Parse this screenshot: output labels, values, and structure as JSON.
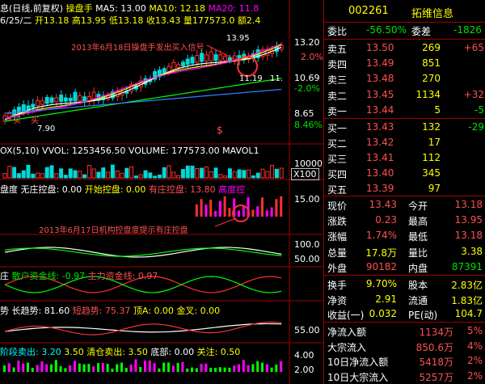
{
  "colors": {
    "up": "#ff3030",
    "down": "#00d8d8",
    "ma5": "#ffffff",
    "ma10": "#ffff00",
    "ma20": "#ff00ff",
    "ma60": "#00ff00",
    "ma120": "#3080ff",
    "grid": "#a00000",
    "accent": "#ff3030"
  },
  "kline": {
    "header_prefix": "息(日线,前复权)",
    "indicator_name": "操盘手",
    "ma5": "MA5: 13.00",
    "ma10": "MA10: 12.18",
    "ma20": "MA20: 11.8",
    "date": "6/25/二",
    "open": "开13.18",
    "high": "高13.95",
    "low": "低13.18",
    "close": "收13.43",
    "vol": "量177573.0",
    "amount": "额2.4",
    "annotation": "2013年6月18日操盘手发出买入信号",
    "price_high": "13.95",
    "price_mid": "11.19",
    "price_mid2": "11.",
    "price_low": "7.90",
    "buy_marks": [
      "买",
      "买"
    ],
    "sell_mark": "$",
    "axis": [
      "13.20",
      "10.69",
      "-2.0%",
      "8.65",
      "8.46%"
    ],
    "axis_pct": [
      "2.0%",
      "-8.46%"
    ]
  },
  "volume": {
    "label": "OX(5,10) VVOL: 1253456.50  VOLUME: 177573.00  MAVOL1",
    "axis": "10000",
    "unit": "X100"
  },
  "control": {
    "name": "盘度",
    "a": "无庄控盘: 0.00",
    "b": "开始控盘: 0.00",
    "c": "有庄控盘: 13.80",
    "d": "高度控",
    "annotation": "2013年6月17日机构控盘度提示有庄控盘",
    "axis": "15.00"
  },
  "macd": {
    "axis_a": "100.0",
    "axis_b": "50.00"
  },
  "money": {
    "name": "庄",
    "a": "散户资金线: -0.97",
    "b": "主力资金线: 0.97"
  },
  "trend": {
    "name": "势",
    "a": "长趋势: 81.60",
    "b": "短趋势: 75.37",
    "c": "顶A: 0.00",
    "d": "金叉: 0.00",
    "axis": "55.00"
  },
  "bottom": {
    "a": "阶段卖出: 3.20",
    "b": "3.50",
    "c": "清仓卖出: 3.50",
    "d": "底部: 0.00",
    "e": "关注: 0.50",
    "axis_a": "4.00",
    "axis_b": "2.00"
  },
  "quote": {
    "code": "002261",
    "name": "拓维信息",
    "wb_label": "委比",
    "wb_val": "-56.50%",
    "wc_label": "委差",
    "wc_val": "-1826",
    "asks": [
      {
        "label": "卖五",
        "price": "13.50",
        "vol": "269",
        "chg": "+65"
      },
      {
        "label": "卖四",
        "price": "13.49",
        "vol": "851",
        "chg": ""
      },
      {
        "label": "卖三",
        "price": "13.48",
        "vol": "270",
        "chg": ""
      },
      {
        "label": "卖二",
        "price": "13.45",
        "vol": "1134",
        "chg": "+32"
      },
      {
        "label": "卖一",
        "price": "13.44",
        "vol": "5",
        "chg": "-5"
      }
    ],
    "bids": [
      {
        "label": "买一",
        "price": "13.43",
        "vol": "132",
        "chg": "-29"
      },
      {
        "label": "买二",
        "price": "13.42",
        "vol": "17",
        "chg": ""
      },
      {
        "label": "买三",
        "price": "13.41",
        "vol": "112",
        "chg": ""
      },
      {
        "label": "买四",
        "price": "13.40",
        "vol": "345",
        "chg": ""
      },
      {
        "label": "买五",
        "price": "13.39",
        "vol": "97",
        "chg": ""
      }
    ],
    "stats": [
      {
        "l1": "现价",
        "v1": "13.43",
        "l2": "今开",
        "v2": "13.18"
      },
      {
        "l1": "涨跌",
        "v1": "0.23",
        "l2": "最高",
        "v2": "13.95"
      },
      {
        "l1": "涨幅",
        "v1": "1.74%",
        "l2": "最低",
        "v2": "13.18"
      },
      {
        "l1": "总量",
        "v1": "17.8万",
        "l2": "量比",
        "v2": "3.38"
      },
      {
        "l1": "外盘",
        "v1": "90182",
        "l2": "内盘",
        "v2": "87391"
      }
    ],
    "fund": [
      {
        "l1": "换手",
        "v1": "9.70%",
        "l2": "股本",
        "v2": "2.83亿"
      },
      {
        "l1": "净资",
        "v1": "2.91",
        "l2": "流通",
        "v2": "1.83亿"
      },
      {
        "l1": "收益(一)",
        "v1": "0.032",
        "l2": "PE(动)",
        "v2": "104.7"
      }
    ],
    "flows": [
      {
        "label": "净流入额",
        "val": "1134万",
        "pct": "5%"
      },
      {
        "label": "大宗流入",
        "val": "850.6万",
        "pct": "4%"
      },
      {
        "label": "10日净流入额",
        "val": "5418万",
        "pct": "2%"
      },
      {
        "label": "10日大宗流入",
        "val": "5257万",
        "pct": "2%"
      }
    ]
  }
}
